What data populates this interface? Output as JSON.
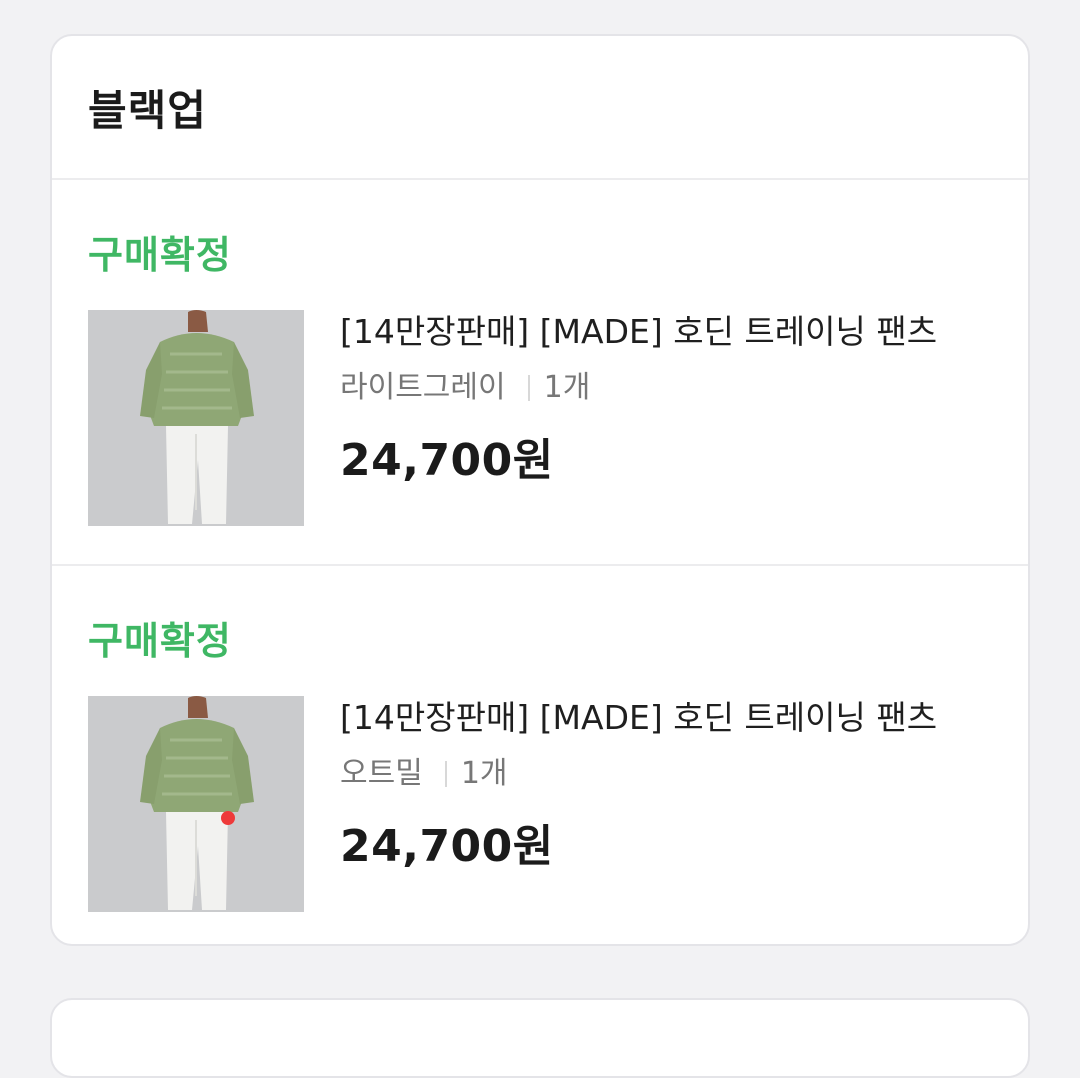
{
  "colors": {
    "status_green": "#3fb764",
    "accent_red": "#ee3a3a"
  },
  "shop": {
    "name": "블랙업"
  },
  "orders": [
    {
      "status": "구매확정",
      "title": "[14만장판매] [MADE] 호딘 트레이닝 팬츠",
      "option": "라이트그레이",
      "quantity": "1개",
      "price": "24,700원",
      "image": "model-wearing-green-knit-and-white-training-pants"
    },
    {
      "status": "구매확정",
      "title": "[14만장판매] [MADE] 호딘 트레이닝 팬츠",
      "option": "오트밀",
      "quantity": "1개",
      "price": "24,700원",
      "image": "model-wearing-green-knit-and-white-training-pants"
    }
  ]
}
